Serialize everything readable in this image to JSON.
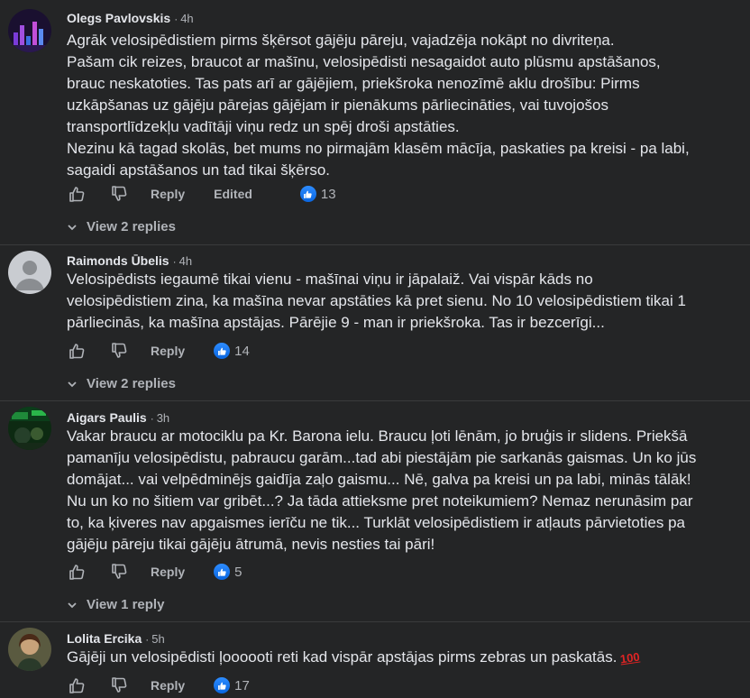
{
  "comments": [
    {
      "author": "Olegs Pavlovskis",
      "time": "4h",
      "body": "Agrāk velosipēdistiem pirms šķērsot gājēju pāreju, vajadzēja nokāpt no divriteņa.\nPašam cik reizes, braucot ar mašīnu, velosipēdisti nesagaidot auto plūsmu apstāšanos, brauc neskatoties. Tas pats arī ar gājējiem, priekšroka nenozīmē aklu drošību: Pirms uzkāpšanas uz gājēju pārejas gājējam ir pienākums pārliecināties, vai tuvojošos transportlīdzekļu vadītāji viņu redz un spēj droši apstāties.\nNezinu kā tagad skolās, bet mums no pirmajām klasēm mācīja, paskaties pa kreisi - pa labi, sagaidi apstāšanos un tad tikai šķērso.",
      "reply_label": "Reply",
      "edited_label": "Edited",
      "reactions": "13",
      "view_replies": "View 2 replies"
    },
    {
      "author": "Raimonds Ūbelis",
      "time": "4h",
      "body": "Velosipēdists iegaumē tikai vienu - mašīnai viņu ir jāpalaiž. Vai vispār kāds no velosipēdistiem zina, ka mašīna nevar apstāties kā pret sienu. No 10 velosipēdistiem tikai 1 pārliecinās, ka mašīna apstājas. Pārējie 9 - man ir priekšroka. Tas ir bezcerīgi...",
      "reply_label": "Reply",
      "reactions": "14",
      "view_replies": "View 2 replies"
    },
    {
      "author": "Aigars Paulis",
      "time": "3h",
      "body": "Vakar braucu ar motociklu pa Kr. Barona ielu. Braucu ļoti lēnām, jo bruģis ir slidens. Priekšā pamanīju velosipēdistu, pabraucu garām...tad abi piestājām pie sarkanās gaismas. Un ko jūs domājat... vai velpēdminējs gaidīja zaļo gaismu... Nē, galva pa kreisi un pa labi, minās tālāk! Nu un ko no šitiem var gribēt...? Ja tāda attieksme pret noteikumiem? Nemaz nerunāsim par to, ka ķiveres nav apgaismes ierīču ne tik... Turklāt velosipēdistiem ir atļauts pārvietoties pa gājēju pāreju tikai gājēju ātrumā, nevis nesties tai pāri!",
      "reply_label": "Reply",
      "reactions": "5",
      "view_replies": "View 1 reply"
    },
    {
      "author": "Lolita Ercika",
      "time": "5h",
      "body": "Gājēji un velosipēdisti ļoooooti reti kad vispār apstājas pirms zebras un paskatās.",
      "emoji": "100",
      "reply_label": "Reply",
      "reactions": "17"
    }
  ],
  "icons": {
    "like": "thumbs-up-icon",
    "dislike": "thumbs-down-icon",
    "reaction": "like-reaction-icon",
    "chevron": "chevron-down-icon"
  },
  "colors": {
    "background": "#242526",
    "text": "#e4e6eb",
    "secondary": "#b0b3b8",
    "like_blue": "#1877f2",
    "emoji_red": "#e02424"
  }
}
